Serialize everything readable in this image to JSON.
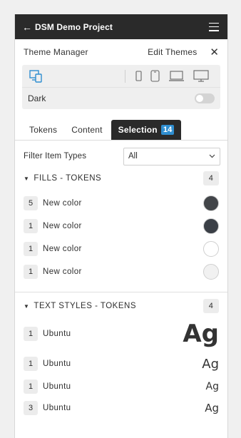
{
  "header": {
    "back_icon": "arrow-left-icon",
    "title": "DSM Demo Project",
    "menu_icon": "hamburger-icon"
  },
  "theme": {
    "manager_label": "Theme Manager",
    "edit_label": "Edit Themes",
    "close_glyph": "✕"
  },
  "devices": {
    "selected": "responsive-icon",
    "options": [
      "phone-small-icon",
      "phone-icon",
      "laptop-icon",
      "desktop-icon"
    ]
  },
  "dark": {
    "label": "Dark",
    "enabled": false
  },
  "tabs": [
    {
      "label": "Tokens"
    },
    {
      "label": "Content"
    },
    {
      "label": "Selection",
      "badge": "14",
      "active": true
    }
  ],
  "filter": {
    "label": "Filter Item Types",
    "value": "All"
  },
  "fills": {
    "title": "FILLS - TOKENS",
    "count": "4",
    "items": [
      {
        "count": "5",
        "name": "New color",
        "color": "#424549"
      },
      {
        "count": "1",
        "name": "New color",
        "color": "#3a3f46"
      },
      {
        "count": "1",
        "name": "New color",
        "color": "#ffffff"
      },
      {
        "count": "1",
        "name": "New color",
        "color": "#f1f1f1"
      }
    ]
  },
  "text_styles": {
    "title": "TEXT STYLES - TOKENS",
    "count": "4",
    "items": [
      {
        "count": "1",
        "name": "Ubuntu",
        "sample": "Ag"
      },
      {
        "count": "1",
        "name": "Ubuntu",
        "sample": "Ag"
      },
      {
        "count": "1",
        "name": "Ubuntu",
        "sample": "Ag"
      },
      {
        "count": "3",
        "name": "Ubuntu",
        "sample": "Ag"
      }
    ]
  }
}
